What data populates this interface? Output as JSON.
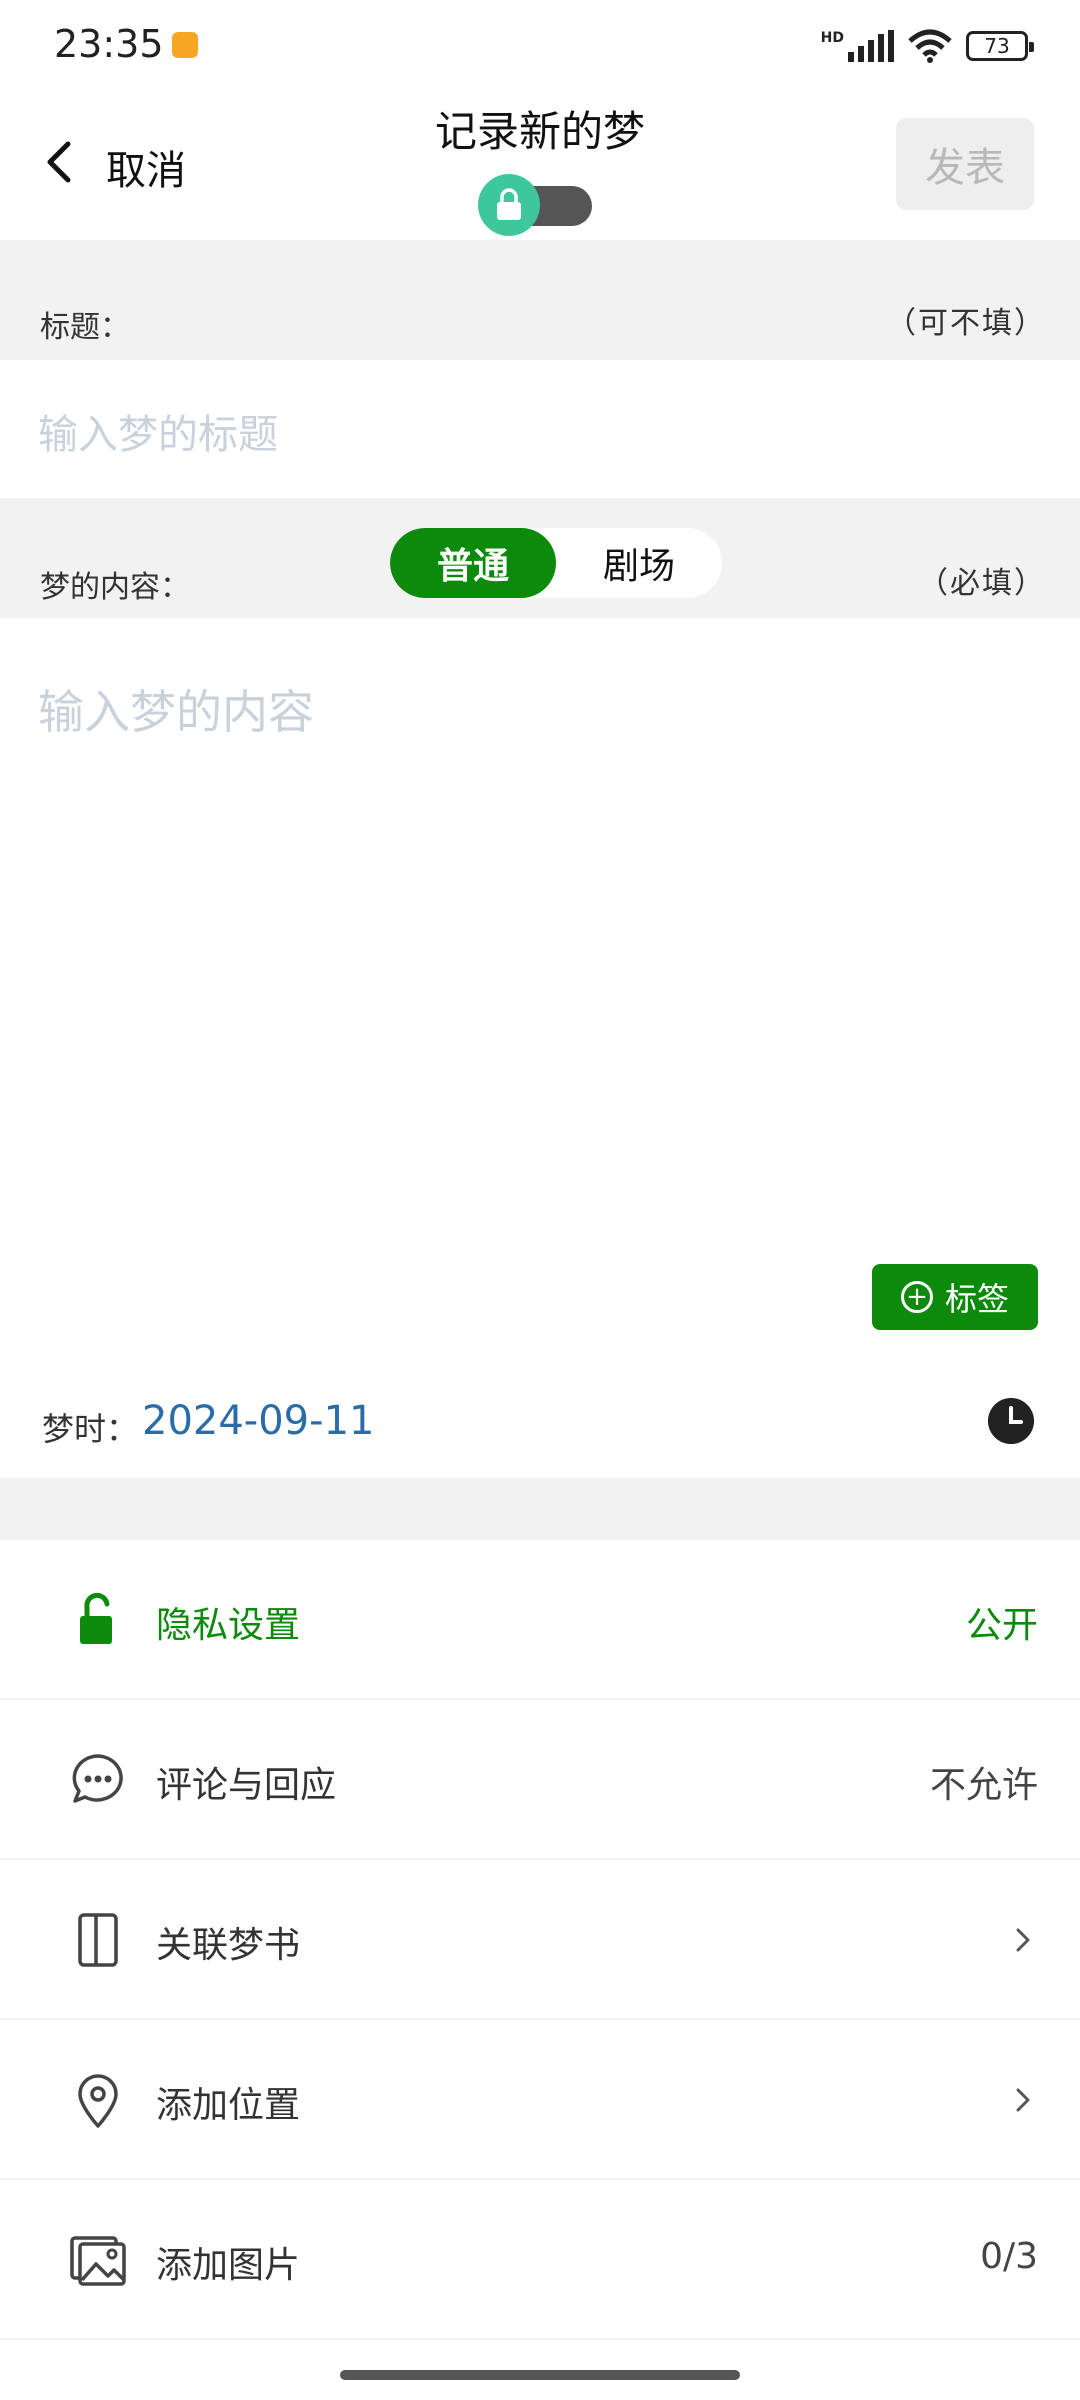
{
  "status_bar": {
    "time": "23:35",
    "network_badge": "HD",
    "battery": "73",
    "icons": [
      "signal-icon",
      "wifi-icon",
      "battery-icon"
    ]
  },
  "header": {
    "cancel_label": "取消",
    "title": "记录新的梦",
    "publish_label": "发表",
    "privacy_toggle_on": false
  },
  "title_section": {
    "label": "标题：",
    "hint": "（可不填）",
    "placeholder": "输入梦的标题"
  },
  "content_section": {
    "label": "梦的内容：",
    "hint": "（必填）",
    "modes": [
      "普通",
      "剧场"
    ],
    "selected_mode": "普通",
    "placeholder": "输入梦的内容"
  },
  "tag_button_label": "标签",
  "dream_time": {
    "label": "梦时：",
    "value": "2024-09-11"
  },
  "settings": [
    {
      "label": "隐私设置",
      "value": "公开",
      "icon": "unlock-icon"
    },
    {
      "label": "评论与回应",
      "value": "不允许",
      "icon": "comment-icon"
    },
    {
      "label": "关联梦书",
      "value": "",
      "icon": "book-icon"
    },
    {
      "label": "添加位置",
      "value": "",
      "icon": "location-icon"
    },
    {
      "label": "添加图片",
      "value": "0/3",
      "icon": "image-icon"
    }
  ],
  "colors": {
    "accent_green": "#0c8a0c",
    "toggle_knob": "#3ec79a",
    "date_blue": "#2a6ca8",
    "placeholder": "#c9d2db"
  }
}
